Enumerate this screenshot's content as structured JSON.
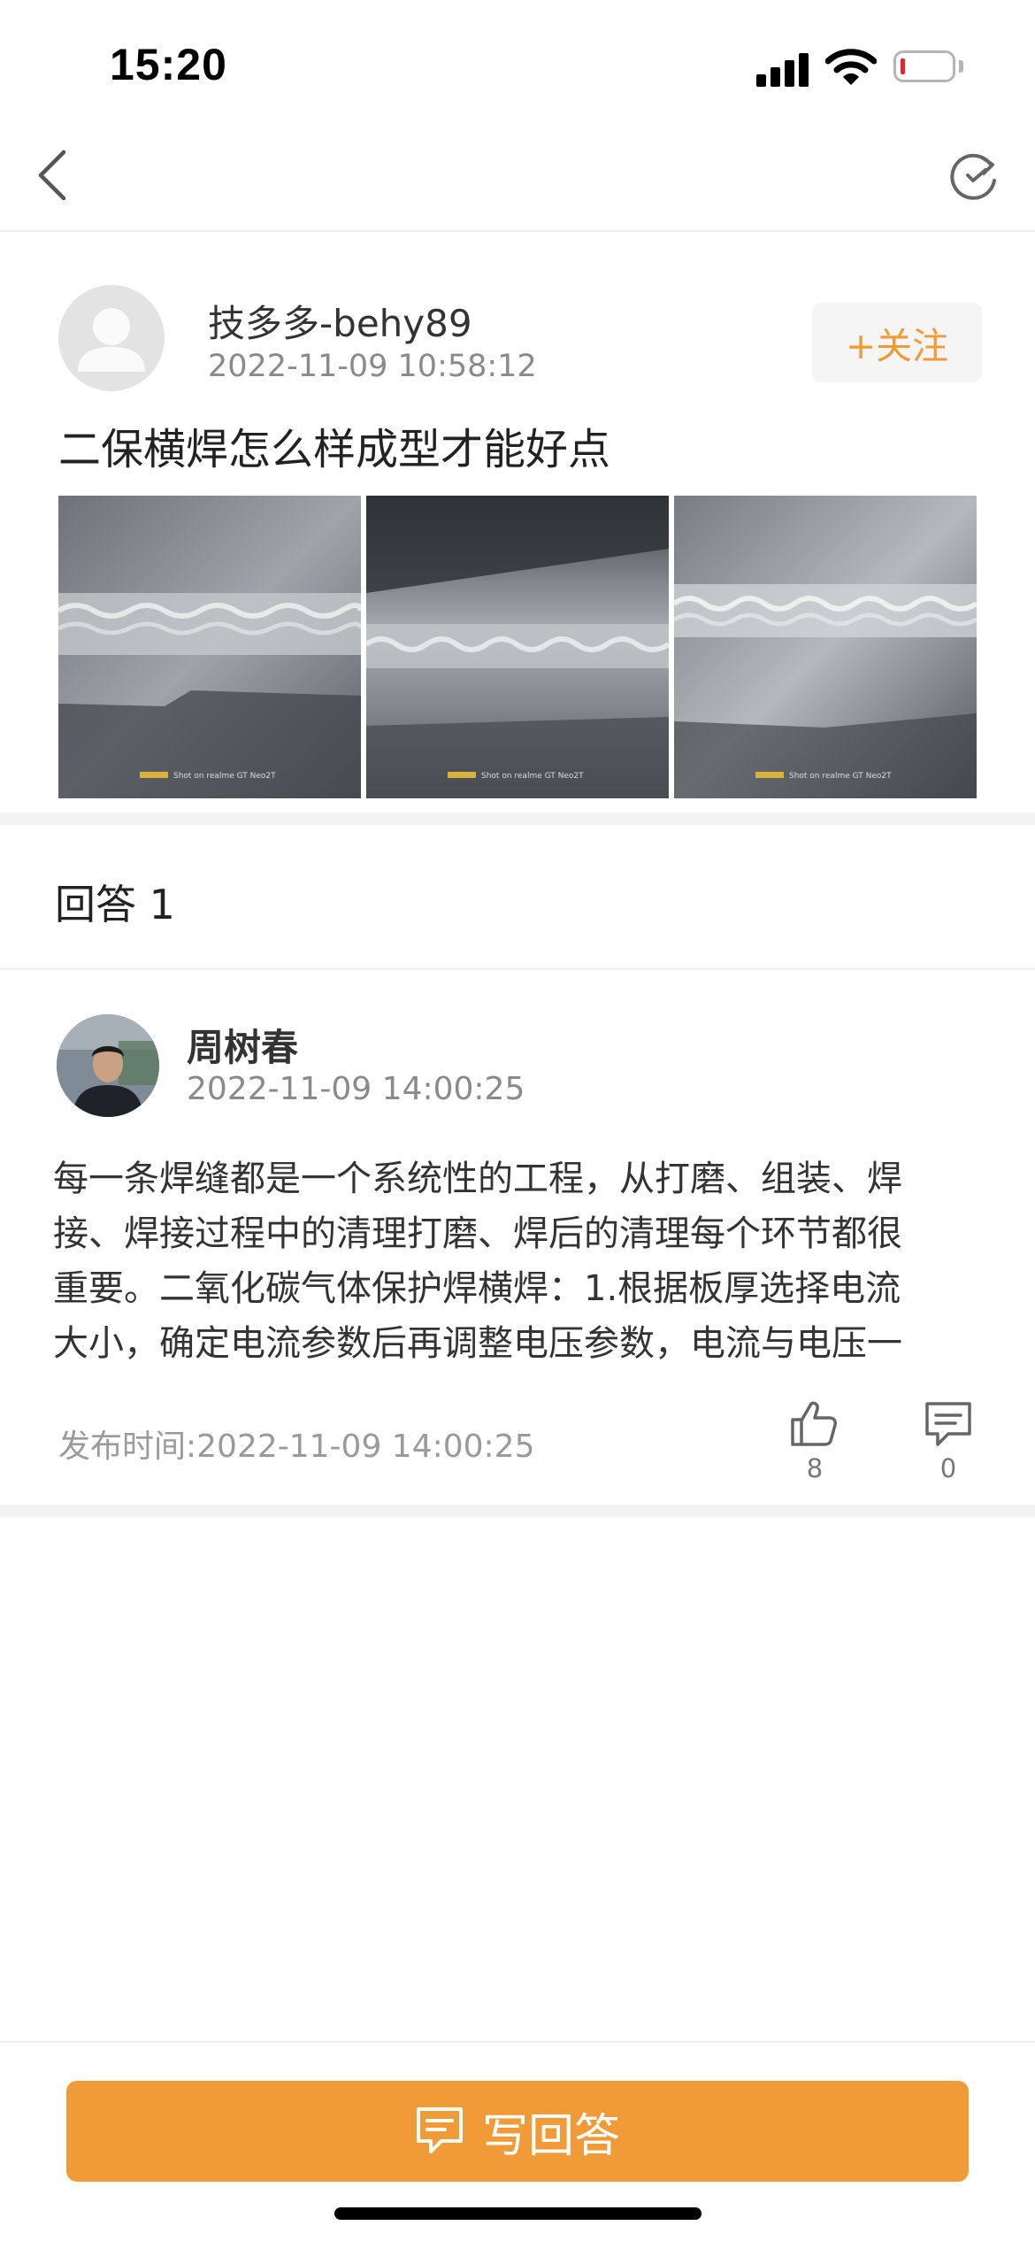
{
  "status_bar": {
    "time": "15:20",
    "icons": [
      "cellular-signal-icon",
      "wifi-icon",
      "battery-low-icon"
    ],
    "battery_color": "#e6262e"
  },
  "nav": {
    "back_icon": "chevron-left-icon",
    "refresh_icon": "refresh-icon"
  },
  "question": {
    "author_name": "技多多-behy89",
    "timestamp": "2022-11-09 10:58:12",
    "follow_label": "+关注",
    "title": "二保横焊怎么样成型才能好点",
    "photo_count": 3,
    "photo_watermark": "Shot on realme GT Neo2T"
  },
  "answers_header": "回答 1",
  "answer": {
    "author_name": "周树春",
    "timestamp": "2022-11-09 14:00:25",
    "body_lines": [
      "每一条焊缝都是一个系统性的工程，从打磨、组装、焊",
      "接、焊接过程中的清理打磨、焊后的清理每个环节都很",
      "重要。二氧化碳气体保护焊横焊：1.根据板厚选择电流",
      "大小，确定电流参数后再调整电压参数，电流与电压一"
    ],
    "publish_time": "发布时间:2022-11-09 14:00:25",
    "likes": "8",
    "comments": "0"
  },
  "bottom": {
    "write_answer_label": "写回答",
    "write_icon": "comment-edit-icon"
  },
  "colors": {
    "accent": "#f19a38",
    "muted_text": "#8a8a8a"
  }
}
